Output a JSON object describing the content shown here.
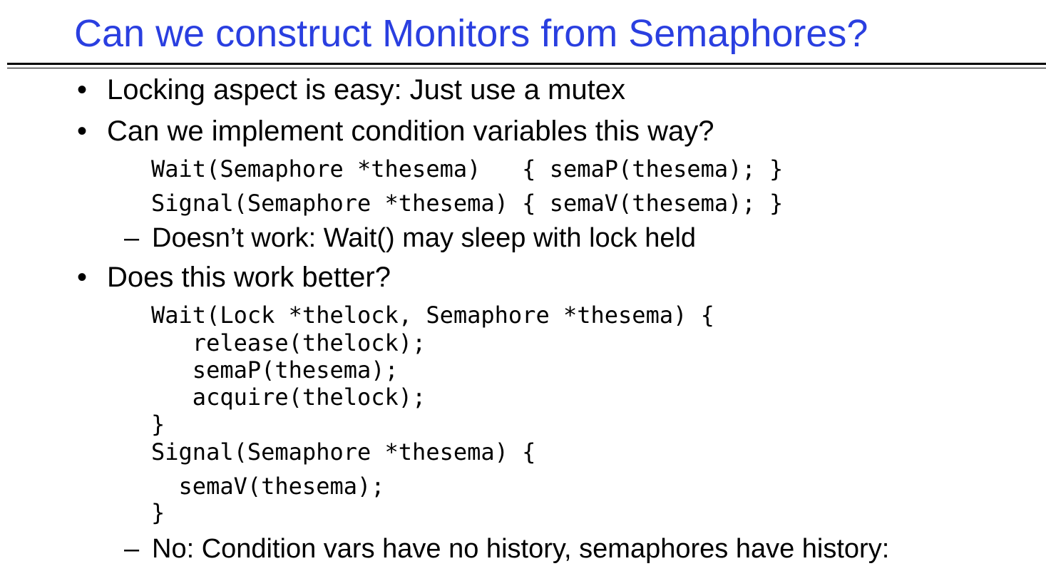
{
  "slide": {
    "title": "Can we construct Monitors from Semaphores?",
    "bullet_symbol": "•",
    "dash_symbol": "–",
    "bullets": [
      {
        "text": "Locking aspect is easy: Just use a mutex"
      },
      {
        "text": "Can we implement condition variables this way?"
      },
      {
        "text": "Does this work better?"
      }
    ],
    "code_block_1": [
      "Wait(Semaphore *thesema)   { semaP(thesema); }",
      "Signal(Semaphore *thesema) { semaV(thesema); }"
    ],
    "sub_1": "Doesn’t work: Wait() may sleep with lock held",
    "code_block_2": [
      "Wait(Lock *thelock, Semaphore *thesema) {",
      "   release(thelock);",
      "   semaP(thesema);",
      "   acquire(thelock);",
      "}",
      "Signal(Semaphore *thesema) {",
      "  semaV(thesema);",
      "}"
    ],
    "sub_2": "No: Condition vars have no history, semaphores have history:"
  },
  "colors": {
    "title": "#2a3fe0",
    "text": "#000000",
    "background": "#ffffff"
  }
}
